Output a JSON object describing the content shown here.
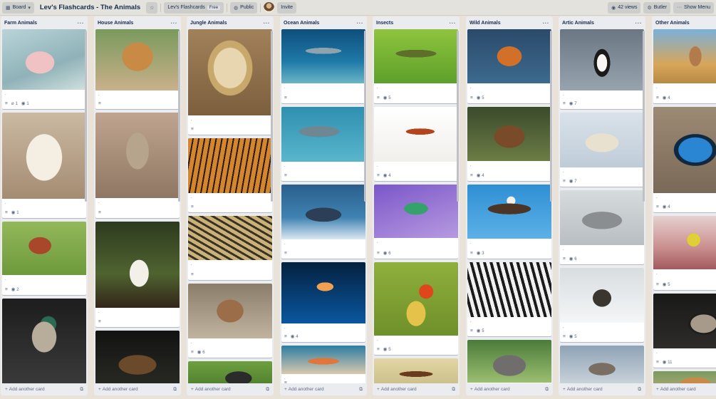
{
  "header": {
    "board_menu": "Board",
    "title": "Lev's Flashcards - The Animals",
    "workspace": "Lev's Flashcards",
    "workspace_badge": "Free",
    "visibility": "Public",
    "invite": "Invite",
    "views": "42 views",
    "butler": "Butler",
    "show_menu": "Show Menu"
  },
  "add_card_label": "Add another card",
  "lists": [
    {
      "title": "Farm Animals",
      "cards": [
        {
          "subject": "pig",
          "attachments": "1",
          "views": "1"
        },
        {
          "subject": "sheep",
          "views": "1"
        },
        {
          "subject": "chicken",
          "views": "2"
        },
        {
          "subject": "duck"
        }
      ]
    },
    {
      "title": "House Animals",
      "cards": [
        {
          "subject": "dog"
        },
        {
          "subject": "cat"
        },
        {
          "subject": "rabbit"
        },
        {
          "subject": "turtle"
        }
      ]
    },
    {
      "title": "Jungle Animals",
      "cards": [
        {
          "subject": "lion"
        },
        {
          "subject": "tiger"
        },
        {
          "subject": "snake"
        },
        {
          "subject": "monkey",
          "views": "6"
        },
        {
          "subject": "gorilla"
        }
      ]
    },
    {
      "title": "Ocean Animals",
      "cards": [
        {
          "subject": "shark"
        },
        {
          "subject": "dolphin"
        },
        {
          "subject": "whale"
        },
        {
          "subject": "jellyfish",
          "views": "4"
        },
        {
          "subject": "crab"
        }
      ]
    },
    {
      "title": "Insects",
      "cards": [
        {
          "subject": "grasshopper",
          "views": "5"
        },
        {
          "subject": "ant",
          "views": "4"
        },
        {
          "subject": "beetle",
          "views": "6"
        },
        {
          "subject": "ladybug",
          "views": "5"
        },
        {
          "subject": "cockroach"
        }
      ]
    },
    {
      "title": "Wild Animals",
      "cards": [
        {
          "subject": "fox",
          "views": "5"
        },
        {
          "subject": "bear",
          "views": "4"
        },
        {
          "subject": "eagle",
          "views": "3"
        },
        {
          "subject": "zebra",
          "views": "5"
        },
        {
          "subject": "elephant"
        }
      ]
    },
    {
      "title": "Artic Animals",
      "cards": [
        {
          "subject": "penguin",
          "views": "7"
        },
        {
          "subject": "polar bear",
          "views": "7"
        },
        {
          "subject": "seal",
          "views": "6"
        },
        {
          "subject": "reindeer",
          "views": "5"
        },
        {
          "subject": "wolf"
        }
      ]
    },
    {
      "title": "Other Animals",
      "cards": [
        {
          "subject": "kangaroo",
          "views": "4"
        },
        {
          "subject": "butterfly",
          "views": "4"
        },
        {
          "subject": "bird",
          "views": "5"
        },
        {
          "subject": "raccoon",
          "views": "11"
        },
        {
          "subject": "dog"
        }
      ]
    }
  ],
  "colors": {
    "list_bg": "#ebecf0",
    "card_bg": "#ffffff",
    "muted_text": "#5e6c84",
    "board_bg": "#e9e2d8"
  },
  "icons": {
    "description": "description-icon",
    "attachment": "paperclip-icon",
    "views": "eye-icon",
    "template": "card-template-icon",
    "more": "ellipsis-icon"
  }
}
